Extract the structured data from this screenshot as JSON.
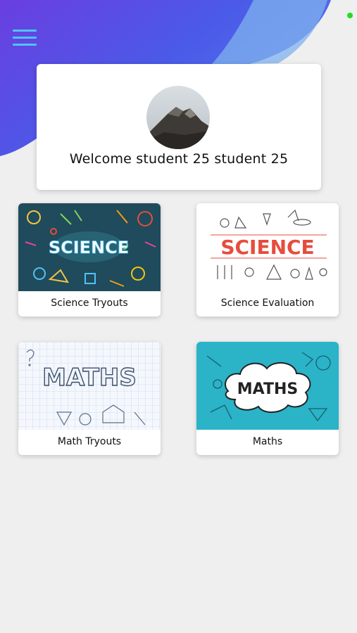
{
  "header": {
    "menu_icon": "hamburger-menu-icon",
    "status_indicator_color": "#22dd22",
    "accent_color": "#4fc3f7"
  },
  "welcome": {
    "text": "Welcome student 25 student 25",
    "avatar_icon": "mountain-avatar"
  },
  "tiles": [
    {
      "label": "Science Tryouts",
      "image_text": "SCIENCE"
    },
    {
      "label": "Science Evaluation",
      "image_text": "SCIENCE"
    },
    {
      "label": "Math Tryouts",
      "image_text": "MATHS"
    },
    {
      "label": "Maths",
      "image_text": "MATHS"
    }
  ]
}
